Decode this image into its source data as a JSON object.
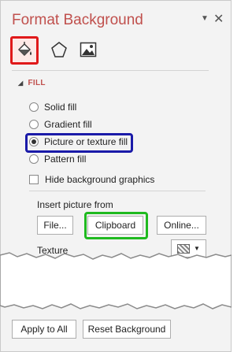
{
  "title": "Format Background",
  "icons": {
    "fill": "paint-bucket-icon",
    "effects": "pentagon-icon",
    "picture": "picture-icon",
    "dropdown": "chevron-down-icon",
    "close": "close-icon"
  },
  "highlight_colors": {
    "red": "#e0191a",
    "blue": "#1a1aa8",
    "green": "#1fba1f",
    "accent": "#c0504d"
  },
  "section": "FILL",
  "radios": [
    {
      "label": "Solid fill",
      "selected": false
    },
    {
      "label": "Gradient fill",
      "selected": false
    },
    {
      "label": "Picture or texture fill",
      "selected": true
    },
    {
      "label": "Pattern fill",
      "selected": false
    }
  ],
  "hide_bg": "Hide background graphics",
  "insert_label": "Insert picture from",
  "buttons": {
    "file": "File...",
    "clipboard": "Clipboard",
    "online": "Online..."
  },
  "texture_label": "Texture",
  "footer": {
    "apply_all": "Apply to All",
    "reset": "Reset Background"
  }
}
